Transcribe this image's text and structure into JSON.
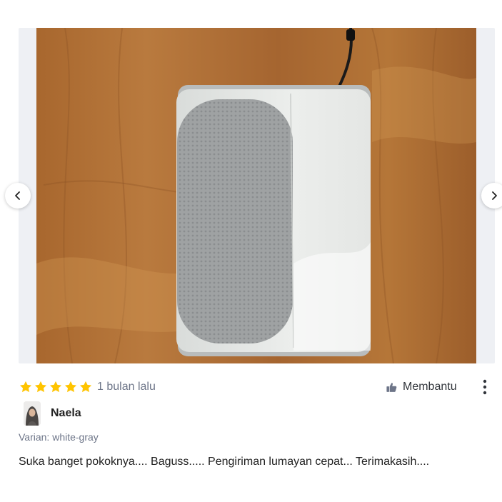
{
  "carousel": {
    "prev_icon": "chevron-left-icon",
    "next_icon": "chevron-right-icon"
  },
  "review": {
    "rating": 5,
    "rating_max": 5,
    "time_ago": "1 bulan lalu",
    "helpful_label": "Membantu",
    "helpful_icon": "thumbs-up-icon",
    "more_icon": "kebab-menu-icon",
    "reviewer_name": "Naela",
    "variant": "Varian: white-gray",
    "text": "Suka banget pokoknya.... Baguss..... Pengiriman lumayan cepat... Terimakasih...."
  },
  "colors": {
    "star": "#ffc400",
    "muted_text": "#6d7588",
    "primary_text": "#212121"
  }
}
